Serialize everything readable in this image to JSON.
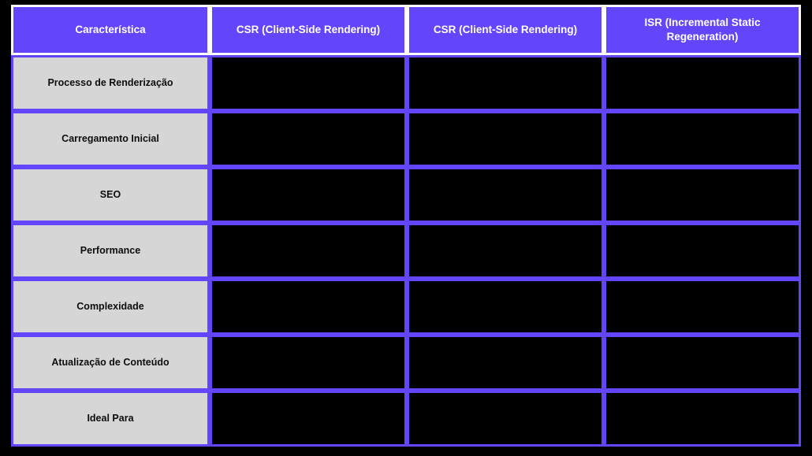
{
  "table": {
    "name": "comparison-table",
    "colors": {
      "accent_purple": "#6345fb",
      "header_text": "#ffffff",
      "feature_cell_bg": "#d6d6d6",
      "feature_cell_text": "#0d0d0d",
      "value_cell_bg": "#000000",
      "page_bg": "#000000",
      "header_border": "#ffffff"
    },
    "headers": [
      "Característica",
      "CSR (Client-Side Rendering)",
      "CSR (Client-Side Rendering)",
      "ISR (Incremental Static Regeneration)"
    ],
    "rows": [
      {
        "feature": "Processo de Renderização",
        "values": [
          "",
          "",
          ""
        ]
      },
      {
        "feature": "Carregamento Inicial",
        "values": [
          "",
          "",
          ""
        ]
      },
      {
        "feature": "SEO",
        "values": [
          "",
          "",
          ""
        ]
      },
      {
        "feature": "Performance",
        "values": [
          "",
          "",
          ""
        ]
      },
      {
        "feature": "Complexidade",
        "values": [
          "",
          "",
          ""
        ]
      },
      {
        "feature": "Atualização de Conteúdo",
        "values": [
          "",
          "",
          ""
        ]
      },
      {
        "feature": "Ideal Para",
        "values": [
          "",
          "",
          ""
        ]
      }
    ]
  }
}
